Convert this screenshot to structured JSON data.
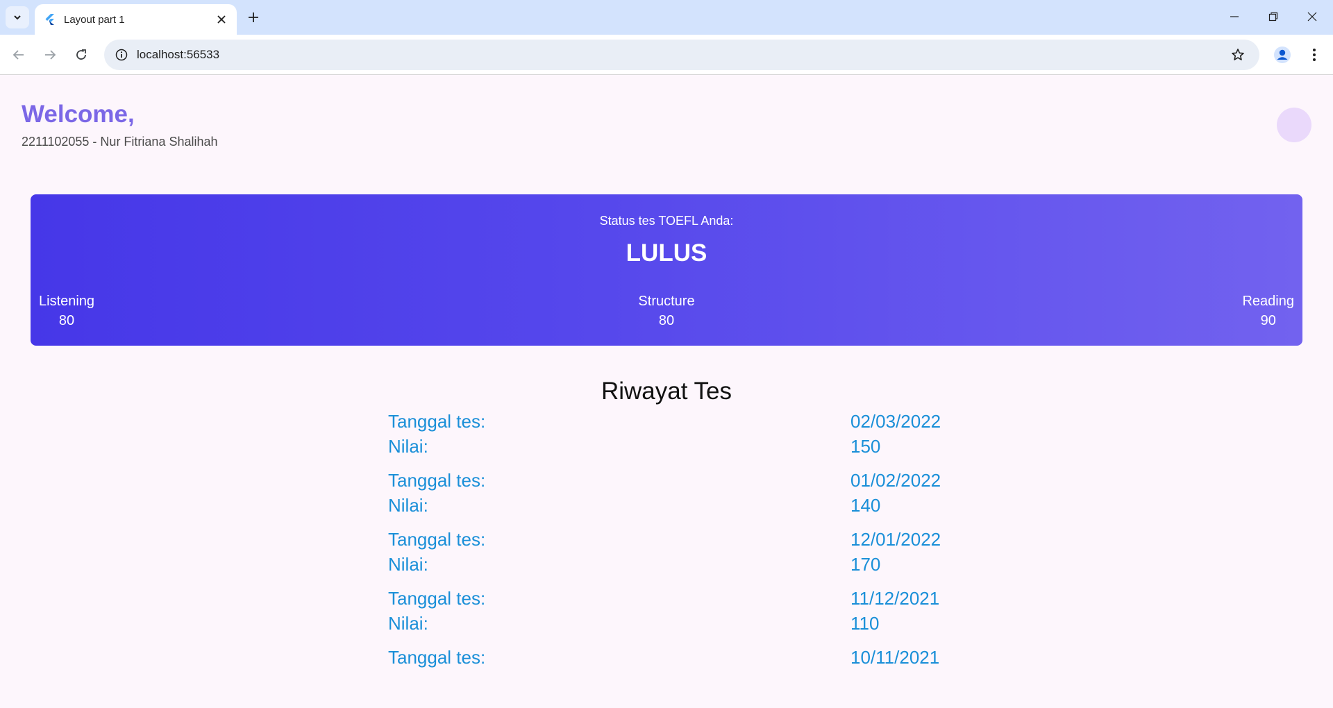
{
  "browser": {
    "tab_title": "Layout part 1",
    "url": "localhost:56533"
  },
  "header": {
    "welcome": "Welcome,",
    "student": "2211102055 - Nur Fitriana Shalihah"
  },
  "status_card": {
    "label": "Status tes TOEFL Anda:",
    "status": "LULUS",
    "scores": [
      {
        "name": "Listening",
        "value": "80"
      },
      {
        "name": "Structure",
        "value": "80"
      },
      {
        "name": "Reading",
        "value": "90"
      }
    ]
  },
  "history": {
    "title": "Riwayat Tes",
    "date_label": "Tanggal tes:",
    "score_label": "Nilai:",
    "entries": [
      {
        "date": "02/03/2022",
        "score": "150"
      },
      {
        "date": "01/02/2022",
        "score": "140"
      },
      {
        "date": "12/01/2022",
        "score": "170"
      },
      {
        "date": "11/12/2021",
        "score": "110"
      },
      {
        "date": "10/11/2021"
      }
    ]
  },
  "colors": {
    "accent": "#7b67e6",
    "card_start": "#4637e8",
    "card_end": "#7262ef",
    "history_text": "#1a8fd8",
    "page_background": "#fdf6fc"
  }
}
